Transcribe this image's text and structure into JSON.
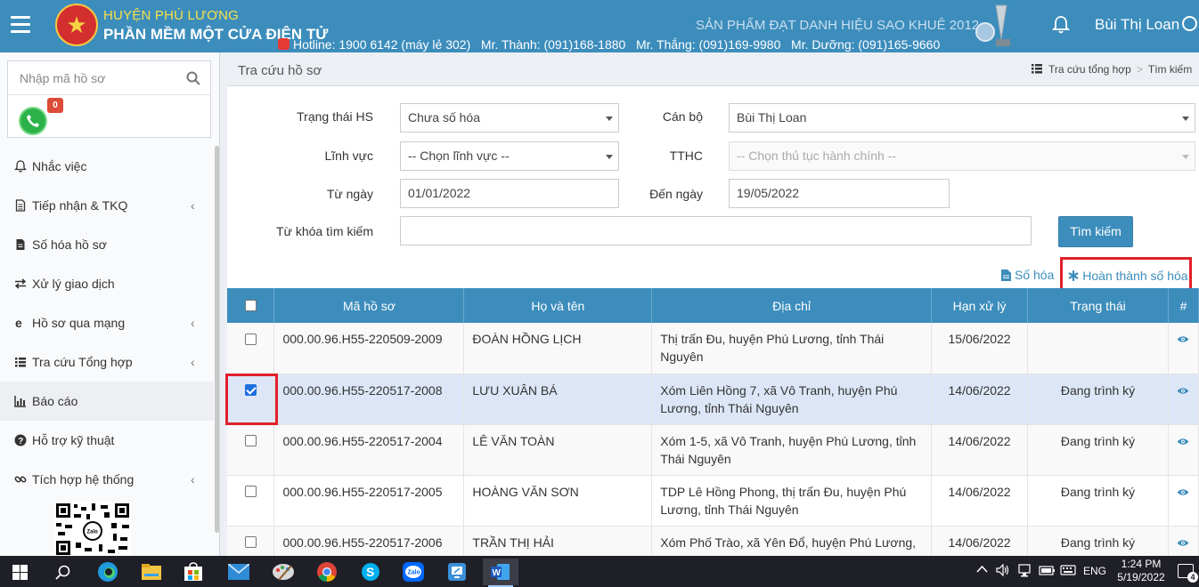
{
  "header": {
    "district": "HUYỆN PHÚ LƯƠNG",
    "app_name": "PHẦN MỀM MỘT CỬA ĐIỆN TỬ",
    "award": "SẢN PHẨM ĐẠT DANH HIỆU SAO KHUÊ 2012",
    "hotline": "Hotline: 1900 6142 (máy lẻ 302)   Mr. Thành: (091)168-1880   Mr. Thắng: (091)169-9980   Mr. Dưỡng: (091)165-9660",
    "username": "Bùi Thị Loan",
    "brand_color": "#3c8dbc"
  },
  "sidebar": {
    "search_placeholder": "Nhập mã hồ sơ",
    "call_badge": "0",
    "items": [
      {
        "label": "Nhắc việc",
        "icon": "bell-icon",
        "has_submenu": false
      },
      {
        "label": "Tiếp nhận & TKQ",
        "icon": "document-icon",
        "has_submenu": true
      },
      {
        "label": "Số hóa hồ sơ",
        "icon": "file-icon",
        "has_submenu": false
      },
      {
        "label": "Xử lý giao dịch",
        "icon": "exchange-icon",
        "has_submenu": false
      },
      {
        "label": "Hồ sơ qua mạng",
        "icon": "internet-explorer-icon",
        "has_submenu": true
      },
      {
        "label": "Tra cứu Tổng hợp",
        "icon": "list-icon",
        "has_submenu": true
      },
      {
        "label": "Báo cáo",
        "icon": "bar-chart-icon",
        "has_submenu": false
      },
      {
        "label": "Hỗ trợ kỹ thuật",
        "icon": "question-circle-icon",
        "has_submenu": false
      },
      {
        "label": "Tích hợp hệ thống",
        "icon": "link-icon",
        "has_submenu": true
      }
    ]
  },
  "page": {
    "title": "Tra cứu hồ sơ",
    "breadcrumb": [
      "Tra cứu tổng hợp",
      "Tìm kiếm"
    ]
  },
  "filters": {
    "status_label": "Trạng thái HS",
    "status_value": "Chưa số hóa",
    "officer_label": "Cán bộ",
    "officer_value": "Bùi Thị Loan",
    "field_label": "Lĩnh vực",
    "field_value": "-- Chọn lĩnh vực --",
    "procedure_label": "TTHC",
    "procedure_value": "-- Chọn thủ tục hành chính --",
    "from_label": "Từ ngày",
    "from_value": "01/01/2022",
    "to_label": "Đến ngày",
    "to_value": "19/05/2022",
    "keyword_label": "Từ khóa tìm kiếm",
    "keyword_value": "",
    "search_button": "Tìm kiếm"
  },
  "actions": {
    "digitize": "Số hóa",
    "complete": "Hoàn thành số hóa"
  },
  "table": {
    "columns": [
      "Mã hồ sơ",
      "Họ và tên",
      "Địa chỉ",
      "Hạn xử lý",
      "Trạng thái",
      "#"
    ],
    "rows": [
      {
        "checked": false,
        "code": "000.00.96.H55-220509-2009",
        "name": "ĐOÀN HỒNG LỊCH",
        "address": "Thị trấn Đu, huyện Phú Lương, tỉnh Thái Nguyên",
        "deadline": "15/06/2022",
        "status": ""
      },
      {
        "checked": true,
        "code": "000.00.96.H55-220517-2008",
        "name": "LƯU XUÂN BÁ",
        "address": "Xóm Liên Hồng 7, xã Vô Tranh, huyện Phú Lương, tỉnh Thái Nguyên",
        "deadline": "14/06/2022",
        "status": "Đang trình ký"
      },
      {
        "checked": false,
        "code": "000.00.96.H55-220517-2004",
        "name": "LÊ VĂN TOÀN",
        "address": "Xóm 1-5, xã Vô Tranh, huyện Phú Lương, tỉnh Thái Nguyên",
        "deadline": "14/06/2022",
        "status": "Đang trình ký"
      },
      {
        "checked": false,
        "code": "000.00.96.H55-220517-2005",
        "name": "HOÀNG VĂN SƠN",
        "address": "TDP Lê Hồng Phong, thị trấn Đu, huyện Phú Lương, tỉnh Thái Nguyên",
        "deadline": "14/06/2022",
        "status": "Đang trình ký"
      },
      {
        "checked": false,
        "code": "000.00.96.H55-220517-2006",
        "name": "TRẦN THỊ HẢI",
        "address": "Xóm Phố Trào, xã Yên Đổ, huyện Phú Lương,",
        "deadline": "14/06/2022",
        "status": "Đang trình ký"
      }
    ]
  },
  "taskbar": {
    "language": "ENG",
    "time": "1:24 PM",
    "date": "5/19/2022",
    "notifications": "4"
  }
}
